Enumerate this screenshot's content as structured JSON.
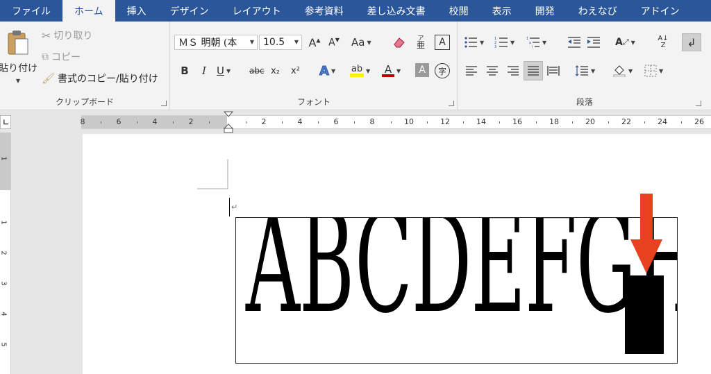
{
  "tabs": [
    "ファイル",
    "ホーム",
    "挿入",
    "デザイン",
    "レイアウト",
    "参考資料",
    "差し込み文書",
    "校閲",
    "表示",
    "開発",
    "わえなび",
    "アドイン"
  ],
  "active_tab": "ホーム",
  "clipboard": {
    "group_label": "クリップボード",
    "paste": "貼り付け",
    "cut": "切り取り",
    "copy": "コピー",
    "format_painter": "書式のコピー/貼り付け"
  },
  "font": {
    "group_label": "フォント",
    "font_name": "ＭＳ 明朝 (本",
    "font_size": "10.5",
    "change_case": "Aa",
    "bold": "B",
    "italic": "I",
    "underline": "U",
    "strike": "abc",
    "subscript": "x₂",
    "superscript": "x²",
    "phonetic": "字"
  },
  "paragraph": {
    "group_label": "段落"
  },
  "ruler": {
    "labels": [
      "8",
      "6",
      "4",
      "2",
      "2",
      "4",
      "6",
      "8",
      "10",
      "12",
      "14",
      "16",
      "18",
      "20",
      "22",
      "24",
      "26"
    ],
    "vertical_labels": [
      "1",
      "1",
      "2",
      "3",
      "4",
      "5"
    ]
  },
  "document": {
    "text": "ABCDEFGH",
    "paragraph_mark": "↵"
  },
  "colors": {
    "tab_bar": "#2b579a",
    "arrow": "#e8411f",
    "highlight": "#ffef00",
    "font_color": "#c00000"
  }
}
